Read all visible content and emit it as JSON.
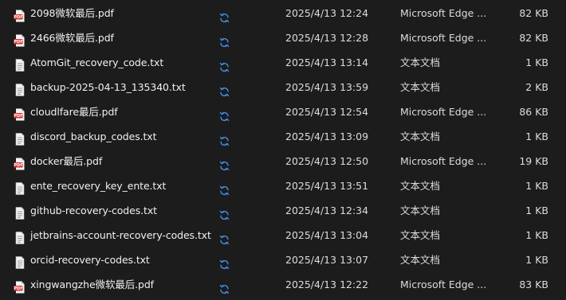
{
  "colors": {
    "background": "#1c1c1c",
    "text": "#e8e8e8",
    "pdf_icon_red": "#d7302b",
    "sync_icon_blue": "#3b8ee6",
    "txt_icon_paper": "#f2f2f2"
  },
  "files": [
    {
      "name": "2098微软最后.pdf",
      "icon": "pdf-file-icon",
      "status_icon": "sync-icon",
      "date": "2025/4/13 12:24",
      "type": "Microsoft Edge ...",
      "size": "82 KB"
    },
    {
      "name": "2466微软最后.pdf",
      "icon": "pdf-file-icon",
      "status_icon": "sync-icon",
      "date": "2025/4/13 12:28",
      "type": "Microsoft Edge ...",
      "size": "82 KB"
    },
    {
      "name": "AtomGit_recovery_code.txt",
      "icon": "text-file-icon",
      "status_icon": "sync-icon",
      "date": "2025/4/13 13:14",
      "type": "文本文档",
      "size": "1 KB"
    },
    {
      "name": "backup-2025-04-13_135340.txt",
      "icon": "text-file-icon",
      "status_icon": "sync-icon",
      "date": "2025/4/13 13:59",
      "type": "文本文档",
      "size": "2 KB"
    },
    {
      "name": "cloudlfare最后.pdf",
      "icon": "pdf-file-icon",
      "status_icon": "sync-icon",
      "date": "2025/4/13 12:54",
      "type": "Microsoft Edge ...",
      "size": "86 KB"
    },
    {
      "name": "discord_backup_codes.txt",
      "icon": "text-file-icon",
      "status_icon": "sync-icon",
      "date": "2025/4/13 13:09",
      "type": "文本文档",
      "size": "1 KB"
    },
    {
      "name": "docker最后.pdf",
      "icon": "pdf-file-icon",
      "status_icon": "sync-icon",
      "date": "2025/4/13 12:50",
      "type": "Microsoft Edge ...",
      "size": "19 KB"
    },
    {
      "name": "ente_recovery_key_ente.txt",
      "icon": "text-file-icon",
      "status_icon": "sync-icon",
      "date": "2025/4/13 13:51",
      "type": "文本文档",
      "size": "1 KB"
    },
    {
      "name": "github-recovery-codes.txt",
      "icon": "text-file-icon",
      "status_icon": "sync-icon",
      "date": "2025/4/13 12:34",
      "type": "文本文档",
      "size": "1 KB"
    },
    {
      "name": "jetbrains-account-recovery-codes.txt",
      "icon": "text-file-icon",
      "status_icon": "sync-icon",
      "date": "2025/4/13 13:04",
      "type": "文本文档",
      "size": "1 KB"
    },
    {
      "name": "orcid-recovery-codes.txt",
      "icon": "text-file-icon",
      "status_icon": "sync-icon",
      "date": "2025/4/13 13:07",
      "type": "文本文档",
      "size": "1 KB"
    },
    {
      "name": "xingwangzhe微软最后.pdf",
      "icon": "pdf-file-icon",
      "status_icon": "sync-icon",
      "date": "2025/4/13 12:22",
      "type": "Microsoft Edge ...",
      "size": "83 KB"
    }
  ]
}
